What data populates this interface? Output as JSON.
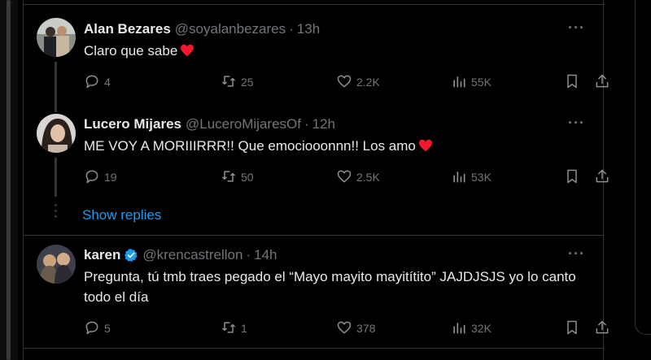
{
  "tweets": [
    {
      "name": "Alan Bezares",
      "handle": "@soyalanbezares",
      "time": "13h",
      "text": "Claro que sabe",
      "replies": "4",
      "retweets": "25",
      "likes": "2.2K",
      "views": "55K",
      "more": "···"
    },
    {
      "name": "Lucero Mijares",
      "handle": "@LuceroMijaresOf",
      "time": "12h",
      "text": "ME VOY A MORIIIRRR!! Que emociooonnn!! Los amo",
      "replies": "19",
      "retweets": "50",
      "likes": "2.5K",
      "views": "53K",
      "more": "···"
    },
    {
      "name": "karen",
      "handle": "@krencastrellon",
      "time": "14h",
      "text": "Pregunta, tú tmb traes pegado el “Mayo mayito mayitítito” JAJDJSJS yo lo canto todo el día",
      "replies": "5",
      "retweets": "1",
      "likes": "378",
      "views": "32K",
      "more": "···"
    }
  ],
  "show_replies": "Show replies",
  "separator": "·",
  "colors": {
    "background": "#000000",
    "text": "#e7e9ea",
    "muted": "#71767b",
    "link": "#1d9bf0",
    "verified": "#1d9bf0",
    "heart": "#f91880",
    "border": "#2f3336"
  }
}
